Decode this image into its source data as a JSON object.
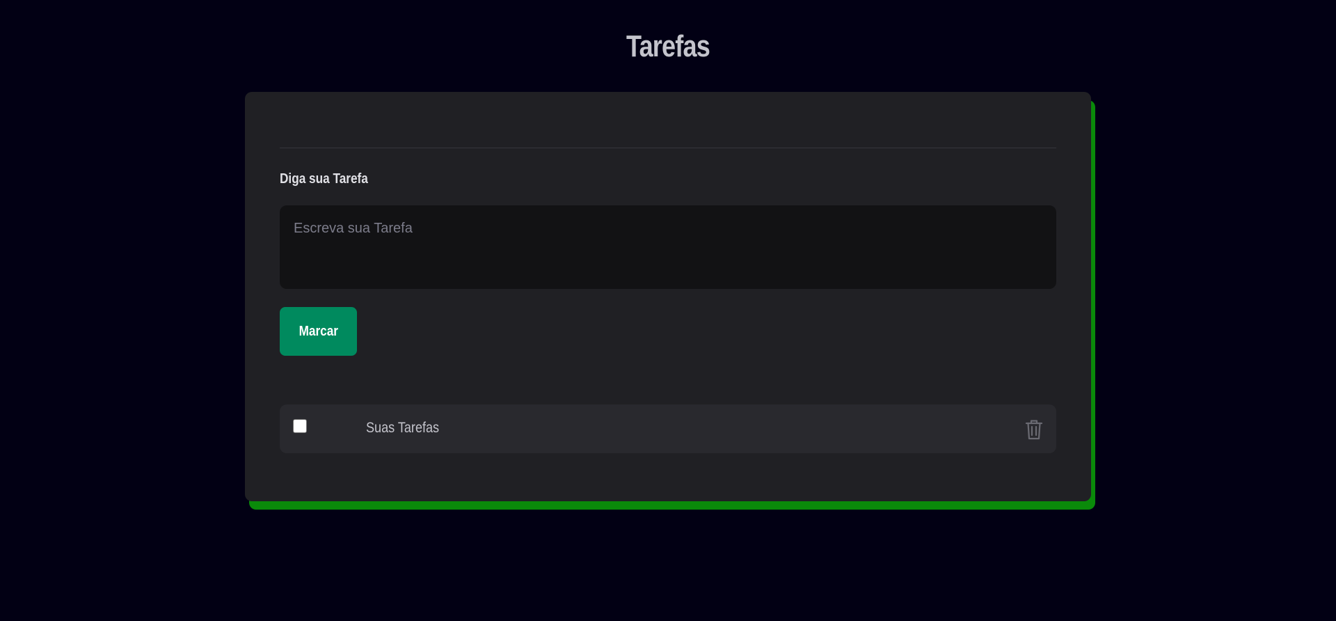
{
  "header": {
    "title": "Tarefas"
  },
  "form": {
    "label": "Diga sua Tarefa",
    "input_placeholder": "Escreva sua Tarefa",
    "input_value": "",
    "submit_label": "Marcar"
  },
  "tasks": [
    {
      "text": "Suas Tarefas",
      "done": false
    }
  ],
  "icons": {
    "delete": "trash-icon"
  },
  "colors": {
    "background": "#020014",
    "card": "#202024",
    "card_shadow": "#0a8a0a",
    "button": "#008a5e",
    "input": "#121214",
    "task_item": "#29292e"
  }
}
